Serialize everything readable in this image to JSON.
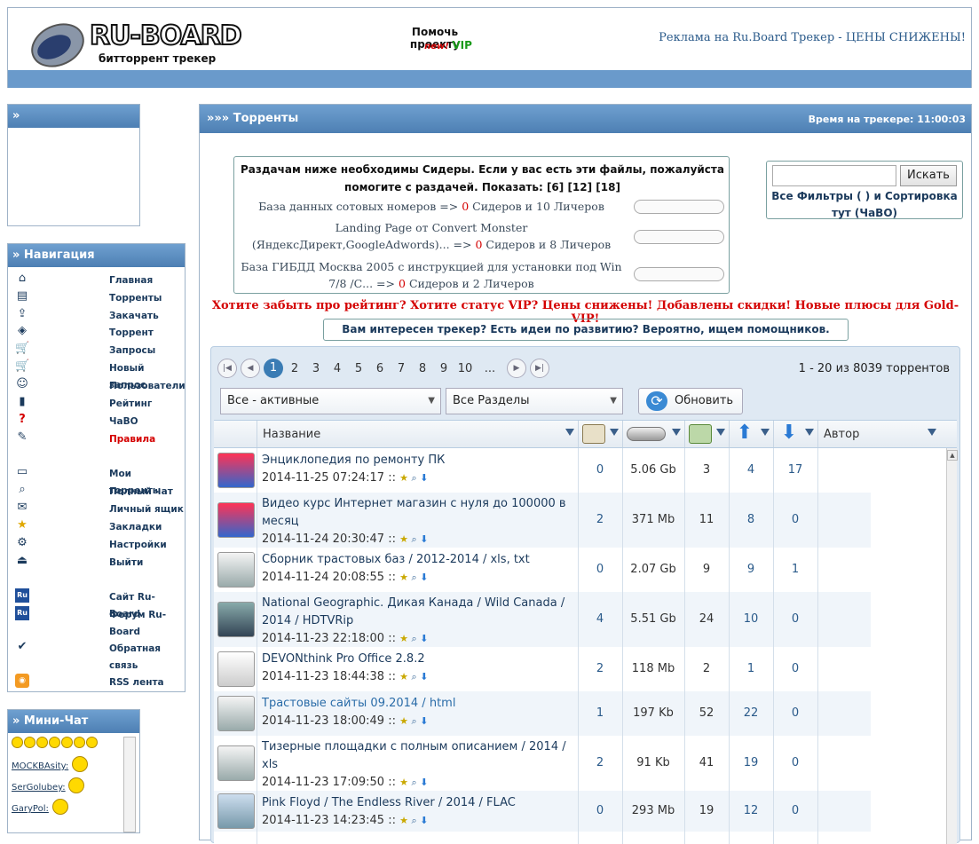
{
  "header": {
    "logo_text": "RU-BOARD",
    "logo_sub": "битторрент трекер",
    "help_label": "Помочь проекту",
    "help_new": "new!",
    "help_vip": "VIP",
    "ad_text": "Реклама на Ru.Board Трекер - ЦЕНЫ СНИЖЕНЫ!"
  },
  "panel1": {
    "title": "»"
  },
  "nav": {
    "title": "» Навигация",
    "items": [
      {
        "label": "Главная",
        "icon": "home-icon"
      },
      {
        "label": "Торренты",
        "icon": "torrents-icon"
      },
      {
        "label": "Закачать",
        "icon": "upload-icon"
      },
      {
        "label": "Торрент",
        "icon": "torrent-icon"
      },
      {
        "label": "Запросы",
        "icon": "cart-icon"
      },
      {
        "label": "Новый запрос",
        "icon": "cart-add-icon"
      },
      {
        "label": "Пользователи",
        "icon": "users-icon"
      },
      {
        "label": "Рейтинг",
        "icon": "rating-icon"
      },
      {
        "label": "ЧаВО",
        "icon": "faq-icon"
      },
      {
        "label": "Правила",
        "icon": "rules-icon"
      },
      {
        "label": "Мои торренты",
        "icon": "folder-icon"
      },
      {
        "label": "Полный чат",
        "icon": "chat-icon"
      },
      {
        "label": "Личный ящик",
        "icon": "mail-icon"
      },
      {
        "label": "Закладки",
        "icon": "star-icon"
      },
      {
        "label": "Настройки",
        "icon": "settings-icon"
      },
      {
        "label": "Выйти",
        "icon": "logout-icon"
      },
      {
        "label": "Сайт Ru-Board",
        "icon": "ru-icon"
      },
      {
        "label": "Форум Ru-Board",
        "icon": "ru-icon"
      },
      {
        "label": "Обратная связь",
        "icon": "feedback-icon"
      },
      {
        "label": "RSS лента",
        "icon": "rss-icon"
      }
    ]
  },
  "chat": {
    "title": "» Мини-Чат",
    "users": [
      "MOCKBAsity:",
      "SerGolubey:",
      "GaryPol:"
    ]
  },
  "main": {
    "title": "»»» Торренты",
    "time": "Время на трекере: 11:00:03",
    "seed_title": "Раздачам ниже необходимы Сидеры. Если у вас есть эти файлы, пожалуйста помогите с раздачей. Показать: [6] [12] [18]",
    "seeds": [
      {
        "name": "База данных сотовых номеров =>",
        "zero": "0",
        "rest": "Сидеров и 10 Личеров"
      },
      {
        "name": "Landing Page от Convert Monster (ЯндексДирект,GoogleAdwords)... =>",
        "zero": "0",
        "rest": "Сидеров и 8 Личеров"
      },
      {
        "name": "База ГИБДД Москва 2005 с инструкцией для установки под Win 7/8 /С... =>",
        "zero": "0",
        "rest": "Сидеров и 2 Личеров"
      }
    ],
    "search_button": "Искать",
    "filter_text": "Все Фильтры ( ) и Сортировка тут (ЧаВО)",
    "promo": "Хотите забыть про рейтинг? Хотите статус VIP? Цены снижены! Добавлены скидки! Новые плюсы для Gold-VIP!",
    "interest": "Вам интересен трекер? Есть идеи по развитию? Вероятно, ищем помощников."
  },
  "pager": {
    "pages": [
      "1",
      "2",
      "3",
      "4",
      "5",
      "6",
      "7",
      "8",
      "9",
      "10",
      "..."
    ],
    "info": "1 - 20 из 8039 торрентов"
  },
  "filters": {
    "status": "Все - активные",
    "section": "Все Разделы",
    "refresh": "Обновить"
  },
  "columns": {
    "name": "Название",
    "author": "Автор"
  },
  "rows": [
    {
      "title": "Энциклопедия по ремонту ПК",
      "date": "2014-11-25 07:24:17 ::",
      "c1": "0",
      "size": "5.06 Gb",
      "c2": "3",
      "seeds": "4",
      "leech": "17",
      "icon": "app-icon"
    },
    {
      "title": "Видео курс Интернет магазин с нуля до 100000 в месяц",
      "date": "2014-11-24 20:30:47 ::",
      "c1": "2",
      "size": "371 Mb",
      "c2": "11",
      "seeds": "8",
      "leech": "0",
      "icon": "app-icon"
    },
    {
      "title": "Сборник трастовых баз / 2012-2014 / xls, txt",
      "date": "2014-11-24 20:08:55 ::",
      "c1": "0",
      "size": "2.07 Gb",
      "c2": "9",
      "seeds": "9",
      "leech": "1",
      "icon": "database-icon"
    },
    {
      "title": "National Geographic. Дикая Канада / Wild Canada / 2014 / HDTVRip",
      "date": "2014-11-23 22:18:00 ::",
      "c1": "4",
      "size": "5.51 Gb",
      "c2": "24",
      "seeds": "10",
      "leech": "0",
      "icon": "film-icon"
    },
    {
      "title": "DEVONthink Pro Office 2.8.2",
      "date": "2014-11-23 18:44:38 ::",
      "c1": "2",
      "size": "118 Mb",
      "c2": "2",
      "seeds": "1",
      "leech": "0",
      "icon": "mac-icon"
    },
    {
      "title": "Трастовые сайты 09.2014 / html",
      "date": "2014-11-23 18:00:49 ::",
      "c1": "1",
      "size": "197 Kb",
      "c2": "52",
      "seeds": "22",
      "leech": "0",
      "icon": "database-icon"
    },
    {
      "title": "Тизерные площадки с полным описанием / 2014 / xls",
      "date": "2014-11-23 17:09:50 ::",
      "c1": "2",
      "size": "91 Kb",
      "c2": "41",
      "seeds": "19",
      "leech": "0",
      "icon": "database-icon"
    },
    {
      "title": "Pink Floyd / The Endless River / 2014 / FLAC",
      "date": "2014-11-23 14:23:45 ::",
      "c1": "0",
      "size": "293 Mb",
      "c2": "19",
      "seeds": "12",
      "leech": "0",
      "icon": "music-icon"
    }
  ]
}
